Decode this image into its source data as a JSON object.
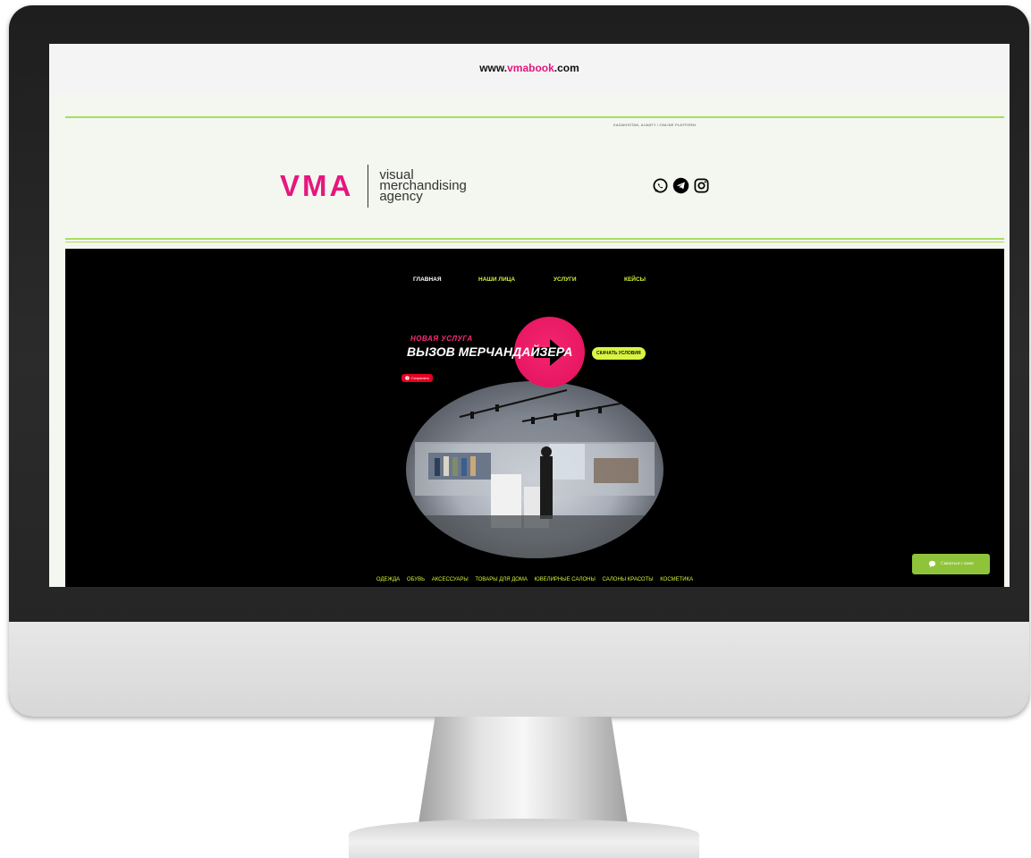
{
  "url": {
    "prefix": "www.",
    "accent": "vmabook",
    "suffix": ".com"
  },
  "header": {
    "location": "KAZAKHSTAN, ALMATY / ONLINE PLATFORM",
    "logo_main": "VMA",
    "logo_tag": [
      "visual",
      "merchandising",
      "agency"
    ],
    "socials": [
      "whatsapp-icon",
      "telegram-icon",
      "instagram-icon"
    ]
  },
  "nav": {
    "items": [
      {
        "label": "ГЛАВНАЯ",
        "active": true
      },
      {
        "label": "НАШИ ЛИЦА",
        "active": false
      },
      {
        "label": "УСЛУГИ",
        "active": false
      },
      {
        "label": "КЕЙСЫ",
        "active": false
      }
    ]
  },
  "promo": {
    "kicker": "НОВАЯ УСЛУГА",
    "title": "ВЫЗОВ МЕРЧАНДАЙЗЕРА",
    "cta_label": "СКАЧАТЬ УСЛОВИЯ",
    "pin_label": "Сохранить"
  },
  "categories": [
    "ОДЕЖДА",
    "ОБУВЬ",
    "АКСЕССУАРЫ",
    "ТОВАРЫ ДЛЯ ДОМА",
    "ЮВЕЛИРНЫЕ САЛОНЫ",
    "САЛОНЫ КРАСОТЫ",
    "КОСМЕТИКА"
  ],
  "chat": {
    "label": "Связаться с нами"
  },
  "colors": {
    "accent": "#e5177e",
    "lime": "#d4f236",
    "line": "#a8de5c",
    "chat": "#8fc43a"
  }
}
